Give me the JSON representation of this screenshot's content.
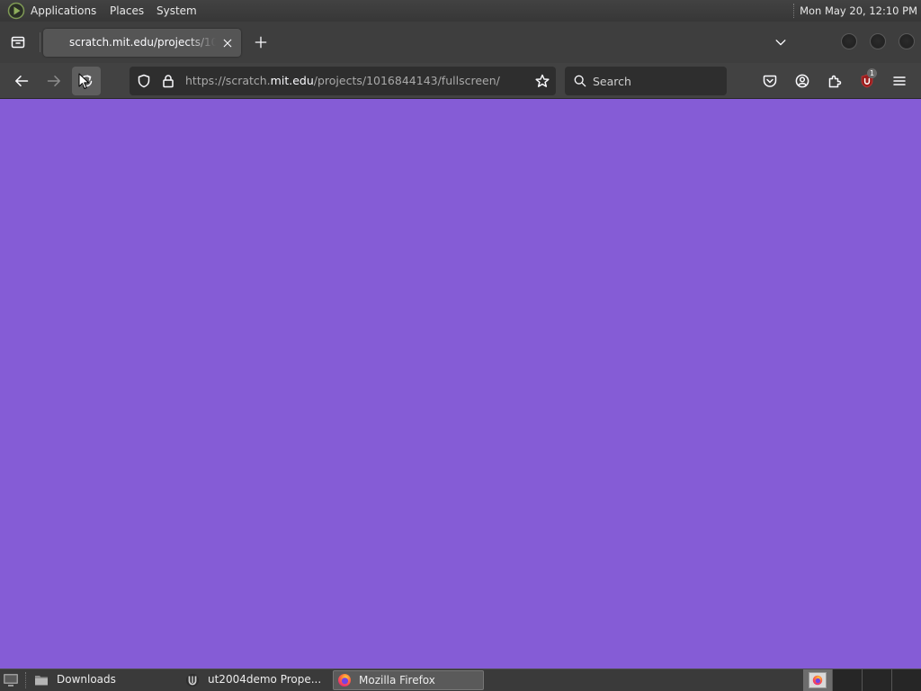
{
  "top_panel": {
    "menus": {
      "applications": "Applications",
      "places": "Places",
      "system": "System"
    },
    "clock": "Mon May 20, 12:10 PM"
  },
  "tabs": [
    {
      "title": "scratch.mit.edu/projects/10",
      "active": true
    }
  ],
  "toolbar": {
    "url": {
      "prefix": "https://scratch.",
      "domain": "mit.edu",
      "path": "/projects/1016844143/fullscreen/"
    },
    "search_placeholder": "Search",
    "ublock_badge": "1",
    "icons": {
      "firefox_view": "firefox-view-icon",
      "back": "back-arrow-icon",
      "forward": "forward-arrow-icon",
      "reload": "reload-icon",
      "tracking_protection": "shield-icon",
      "security": "lock-icon",
      "bookmark": "star-icon",
      "search": "search-icon",
      "pocket": "pocket-icon",
      "account": "account-icon",
      "extensions": "puzzle-piece-icon",
      "ublock": "ublock-origin-icon",
      "menu": "hamburger-menu-icon"
    }
  },
  "page": {
    "background_color": "#855cd6"
  },
  "taskbar": {
    "items": [
      {
        "label": "Downloads",
        "icon": "folder-icon",
        "active": false
      },
      {
        "label": "ut2004demo Prope...",
        "icon": "ut2004-icon",
        "active": false
      },
      {
        "label": "Mozilla Firefox",
        "icon": "firefox-icon",
        "active": true
      }
    ]
  },
  "workspace_switcher": {
    "active": 1
  }
}
